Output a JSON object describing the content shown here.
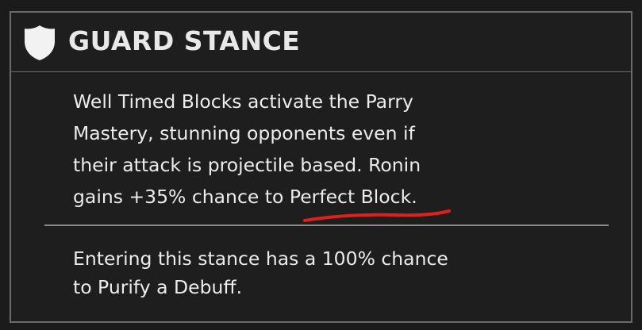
{
  "ability": {
    "title": "GUARD STANCE",
    "icon": "shield-icon",
    "description_lines": [
      "Well Timed Blocks activate the Parry",
      "Mastery, stunning opponents even if",
      "their attack is projectile based. Ronin",
      "gains +35% chance to Perfect Block."
    ],
    "note_lines": [
      "Entering this stance has a 100% chance",
      "to Purify a Debuff."
    ]
  },
  "annotation": {
    "type": "red-underline",
    "target_text": "Perfect Block",
    "color": "#e0201a"
  },
  "colors": {
    "background": "#1e1e1e",
    "border": "#6a6a6a",
    "text": "#ececec",
    "title": "#e8e8e8"
  }
}
